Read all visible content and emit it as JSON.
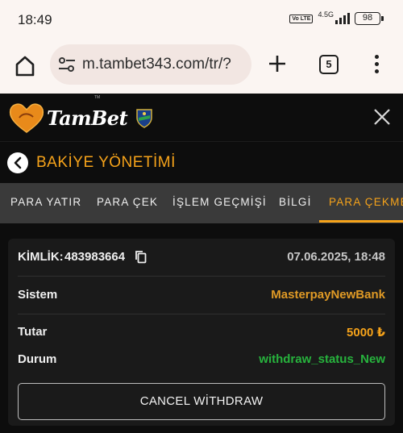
{
  "status_bar": {
    "time": "18:49",
    "volte": "Vo LTE",
    "network": "4.5G",
    "battery": "98"
  },
  "browser": {
    "url": "m.tambet343.com/tr/?",
    "tab_count": "5"
  },
  "site": {
    "brand": "TamBet",
    "trademark": "TM"
  },
  "page": {
    "title": "BAKİYE YÖNETİMİ"
  },
  "tabs": [
    {
      "label": "PARA YATIR"
    },
    {
      "label": "PARA ÇEK"
    },
    {
      "label": "İŞLEM GEÇMİŞİ"
    },
    {
      "label": "BİLGİ"
    },
    {
      "label": "PARA ÇEKME"
    }
  ],
  "withdrawal": {
    "id_label": "KİMLİK:",
    "id_value": "483983664",
    "datetime": "07.06.2025, 18:48",
    "system_label": "Sistem",
    "system_value": "MasterpayNewBank",
    "amount_label": "Tutar",
    "amount_value": "5000 ₺",
    "status_label": "Durum",
    "status_value": "withdraw_status_New",
    "cancel_label": "CANCEL WİTHDRAW"
  },
  "colors": {
    "accent": "#f6a31a",
    "status_ok": "#27b33d",
    "background": "#0d0d0d",
    "card": "#1a1a1a"
  }
}
